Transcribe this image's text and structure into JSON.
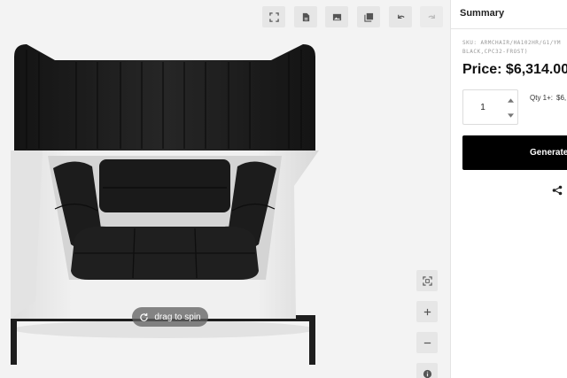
{
  "toolbar": {
    "buttons": [
      {
        "icon": "fullscreen-icon"
      },
      {
        "icon": "document-icon"
      },
      {
        "icon": "image-icon"
      },
      {
        "icon": "gallery-icon"
      },
      {
        "icon": "undo-icon"
      },
      {
        "icon": "redo-icon",
        "disabled": true
      }
    ]
  },
  "viewer": {
    "spin_label": "drag to spin",
    "side_controls": [
      "fit-view-icon",
      "zoom-in-icon",
      "zoom-out-icon",
      "info-icon"
    ]
  },
  "summary": {
    "title": "Summary",
    "sku_line1": "SKU: ARMCHAIR/HA102HR/G1/YM",
    "sku_line2": "BLACK,CPC32-FROST)",
    "price": "Price: $6,314.00",
    "quantity": "1",
    "tier_label": "Qty 1+:",
    "tier_price": "$6,",
    "generate_label": "Generate",
    "share_icon": "share-icon"
  },
  "colors": {
    "upholstery": "#1b1b1b",
    "shell": "#e9e9e9",
    "button": "#000000"
  }
}
